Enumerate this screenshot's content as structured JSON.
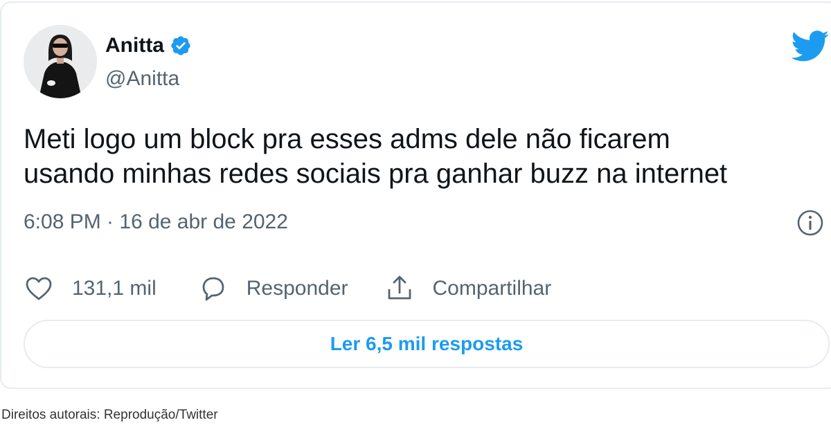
{
  "tweet": {
    "author": {
      "display_name": "Anitta",
      "handle": "@Anitta",
      "verified_icon": "verified-badge-icon",
      "avatar": "avatar-photo"
    },
    "text": "Meti logo um block pra esses adms dele não ficarem\nusando minhas redes sociais pra ganhar buzz na internet",
    "timestamp": "6:08 PM · 16 de abr de 2022",
    "actions": {
      "like_count": "131,1 mil",
      "reply_label": "Responder",
      "share_label": "Compartilhar"
    },
    "read_replies_label": "Ler 6,5 mil respostas",
    "brand_icon": "twitter-bird-icon",
    "info_icon": "info-icon"
  },
  "caption": "Direitos autorais: Reprodução/Twitter",
  "colors": {
    "accent": "#1d9bf0",
    "text_primary": "#0f1419",
    "text_secondary": "#536471",
    "border": "#e6ecf0"
  }
}
